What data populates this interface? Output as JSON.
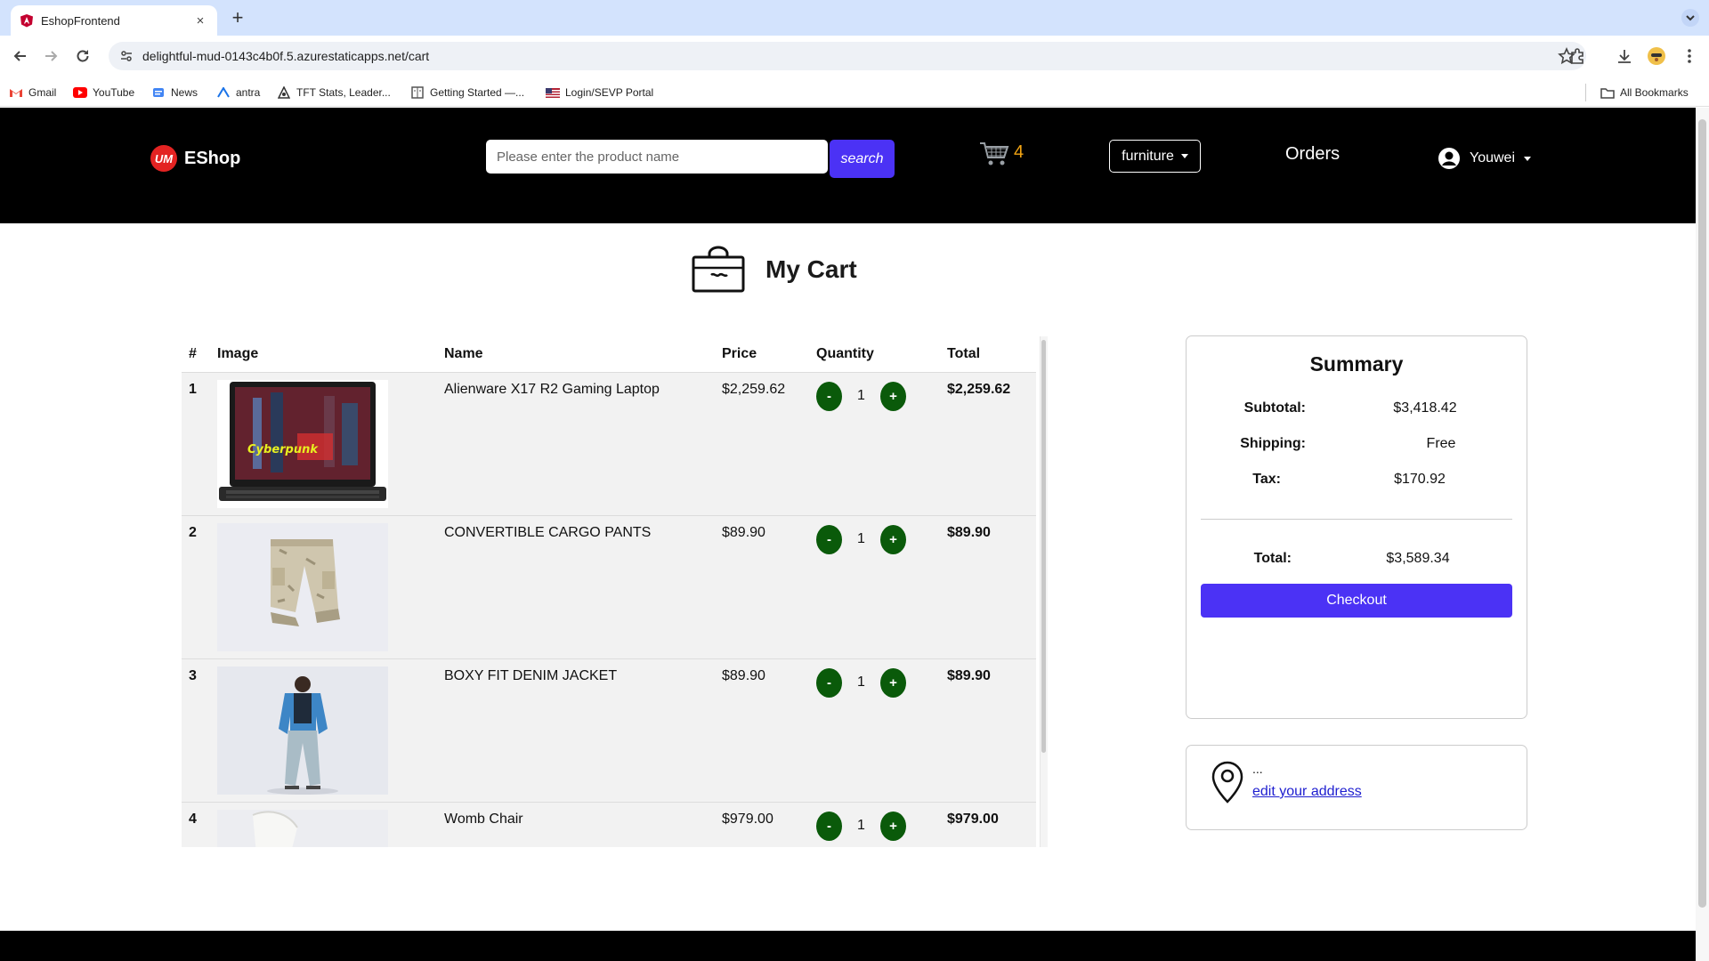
{
  "browser": {
    "tab_title": "EshopFrontend",
    "tab_close": "×",
    "new_tab": "+",
    "url": "delightful-mud-0143c4b0f.5.azurestaticapps.net/cart",
    "bookmarks": [
      {
        "label": "Gmail",
        "icon": "gmail-icon",
        "color": "#ea4335"
      },
      {
        "label": "YouTube",
        "icon": "youtube-icon",
        "color": "#ff0000"
      },
      {
        "label": "News",
        "icon": "news-icon",
        "color": "#4285f4"
      },
      {
        "label": "antra",
        "icon": "antra-icon",
        "color": "#1a73e8"
      },
      {
        "label": "TFT Stats, Leader...",
        "icon": "tft-icon",
        "color": "#333333"
      },
      {
        "label": "Getting Started —...",
        "icon": "document-icon",
        "color": "#555555"
      },
      {
        "label": "Login/SEVP Portal",
        "icon": "flag-icon",
        "color": "#b22234"
      }
    ],
    "all_bookmarks": "All Bookmarks"
  },
  "header": {
    "logo_badge": "UM",
    "logo_text": "EShop",
    "search_placeholder": "Please enter the product name",
    "search_button": "search",
    "cart_count": "4",
    "category": "furniture",
    "orders": "Orders",
    "user": "Youwei"
  },
  "page": {
    "title": "My Cart"
  },
  "cart": {
    "columns": [
      "#",
      "Image",
      "Name",
      "Price",
      "Quantity",
      "Total"
    ],
    "minus": "-",
    "plus": "+",
    "items": [
      {
        "index": "1",
        "name": "Alienware X17 R2 Gaming Laptop",
        "price": "$2,259.62",
        "quantity": "1",
        "total": "$2,259.62",
        "image": "laptop"
      },
      {
        "index": "2",
        "name": "CONVERTIBLE CARGO PANTS",
        "price": "$89.90",
        "quantity": "1",
        "total": "$89.90",
        "image": "pants"
      },
      {
        "index": "3",
        "name": "BOXY FIT DENIM JACKET",
        "price": "$89.90",
        "quantity": "1",
        "total": "$89.90",
        "image": "jacket"
      },
      {
        "index": "4",
        "name": "Womb Chair",
        "price": "$979.00",
        "quantity": "1",
        "total": "$979.00",
        "image": "chair"
      }
    ]
  },
  "summary": {
    "title": "Summary",
    "subtotal_label": "Subtotal:",
    "subtotal": "$3,418.42",
    "shipping_label": "Shipping:",
    "shipping": "Free",
    "tax_label": "Tax:",
    "tax": "$170.92",
    "total_label": "Total:",
    "total": "$3,589.34",
    "checkout": "Checkout"
  },
  "address": {
    "text": "...",
    "edit_link": "edit your address"
  },
  "colors": {
    "accent": "#4b32f5",
    "qty_button": "#0a5a0a",
    "cart_count": "#f2a413",
    "logo": "#e32322"
  }
}
